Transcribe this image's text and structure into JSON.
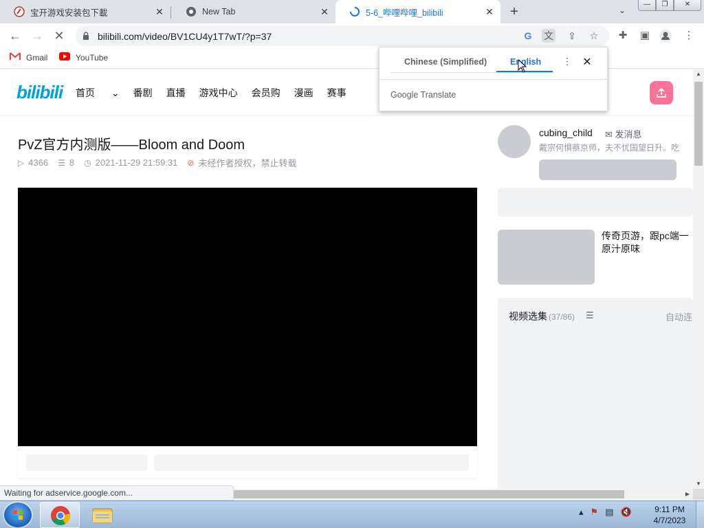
{
  "tabs": [
    {
      "title": "宝开游戏安装包下載",
      "icon": "pvz-favicon"
    },
    {
      "title": "New Tab",
      "icon": "chrome-favicon"
    },
    {
      "title": "5-6_哔哩哔哩_bilibili",
      "icon": "loading-spinner",
      "active": true
    }
  ],
  "toolbar": {
    "url": "bilibili.com/video/BV1CU4y1T7wT/?p=37"
  },
  "bookmarks": [
    {
      "label": "Gmail",
      "icon": "gmail-icon"
    },
    {
      "label": "YouTube",
      "icon": "youtube-icon"
    }
  ],
  "translate": {
    "source_lang": "Chinese (Simplified)",
    "target_lang": "English",
    "brand": "Google Translate",
    "accent": "#1a73e8"
  },
  "bili": {
    "logo": "bilibili",
    "nav": [
      "首页",
      "番剧",
      "直播",
      "游戏中心",
      "会员购",
      "漫画",
      "赛事"
    ],
    "brand_color": "#00a1d6",
    "upload_color": "#fb7299"
  },
  "video": {
    "title": "PvZ官方内测版——Bloom and Doom",
    "views": "4366",
    "danmaku": "8",
    "date": "2021-11-29 21:59:31",
    "copyright": "未经作者授权，禁止转载"
  },
  "uploader": {
    "name": "cubing_child",
    "message": "发消息",
    "desc": "戴宗何惧蔡京师，夫不忧国望日升。吃"
  },
  "recommend": {
    "title": "传奇页游，跟pc端一原汁原味"
  },
  "playlist": {
    "title": "视频选集",
    "count": "(37/86)",
    "autoplay": "自动连"
  },
  "status": "Waiting for adservice.google.com...",
  "taskbar": {
    "time": "9:11 PM",
    "date": "4/7/2023"
  }
}
